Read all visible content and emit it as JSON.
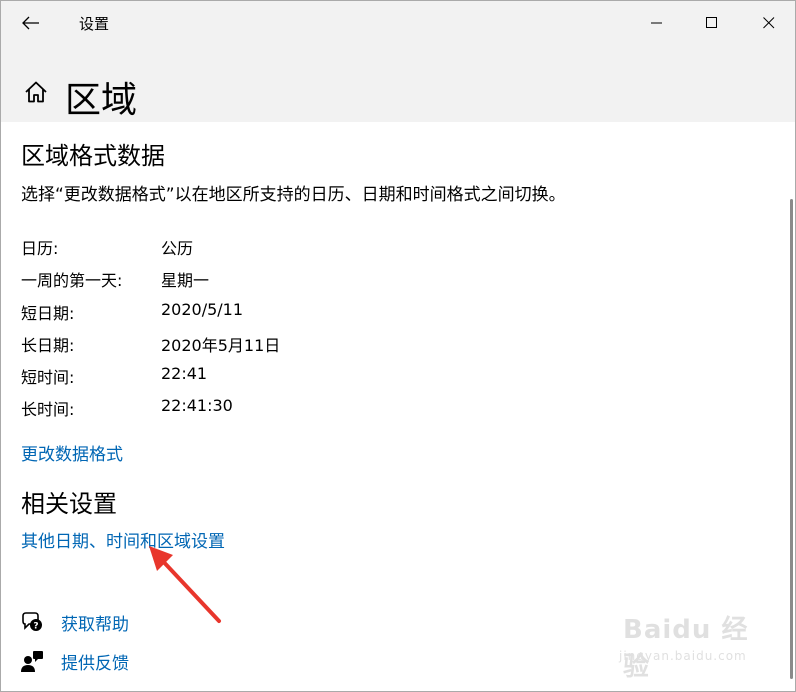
{
  "titlebar": {
    "app_title": "设置",
    "back_icon": "back-arrow-icon",
    "controls": [
      "minimize-icon",
      "maximize-icon",
      "close-icon"
    ]
  },
  "header": {
    "home_icon": "home-icon",
    "page_title": "区域"
  },
  "region_format": {
    "heading": "区域格式数据",
    "description": "选择“更改数据格式”以在地区所支持的日历、日期和时间格式之间切换。",
    "rows": [
      {
        "label": "日历:",
        "value": "公历"
      },
      {
        "label": "一周的第一天:",
        "value": "星期一"
      },
      {
        "label": "短日期:",
        "value": "2020/5/11"
      },
      {
        "label": "长日期:",
        "value": "2020年5月11日"
      },
      {
        "label": "短时间:",
        "value": "22:41"
      },
      {
        "label": "长时间:",
        "value": "22:41:30"
      }
    ],
    "change_link": "更改数据格式"
  },
  "related": {
    "heading": "相关设置",
    "other_link": "其他日期、时间和区域设置"
  },
  "help": {
    "get_help": "获取帮助",
    "feedback": "提供反馈"
  },
  "colors": {
    "link": "#0066b4",
    "header_bg": "#f2f2f2",
    "annotation": "#e8362c"
  },
  "watermark": {
    "brand": "Baidu 经验",
    "sub": "jingyan.baidu.com"
  }
}
